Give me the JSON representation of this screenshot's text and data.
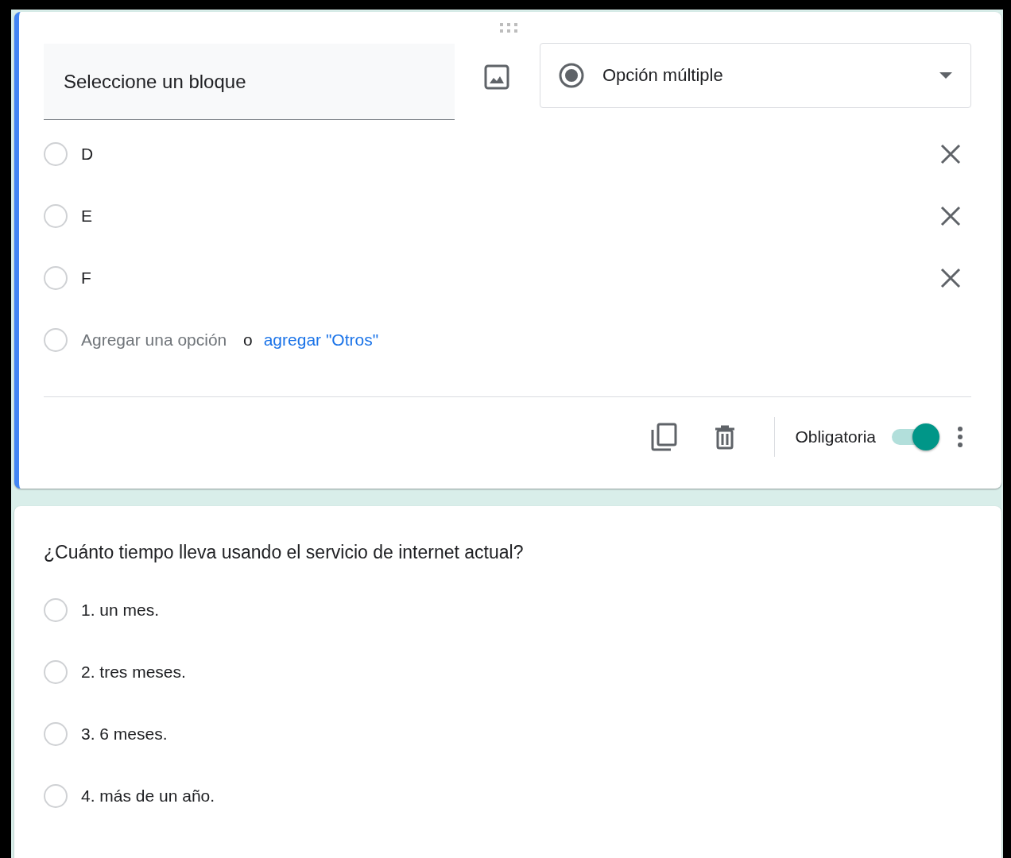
{
  "question_card": {
    "title_field": {
      "value": "Seleccione un bloque"
    },
    "question_type": {
      "label": "Opción múltiple"
    },
    "options": [
      {
        "label": "D",
        "selected": false
      },
      {
        "label": "E",
        "selected": false
      },
      {
        "label": "F",
        "selected": false
      }
    ],
    "add_option": {
      "selected": false,
      "placeholder": "Agregar una opción",
      "separator": "o",
      "link": "agregar \"Otros\""
    },
    "footer": {
      "required_label": "Obligatoria",
      "required": true
    }
  },
  "preview_card": {
    "title": "¿Cuánto tiempo lleva usando el servicio de internet actual?",
    "options": [
      {
        "label": "1. un mes.",
        "selected": false
      },
      {
        "label": "2. tres meses.",
        "selected": false
      },
      {
        "label": "3. 6 meses.",
        "selected": false
      },
      {
        "label": "4. más de un año.",
        "selected": false
      }
    ]
  }
}
